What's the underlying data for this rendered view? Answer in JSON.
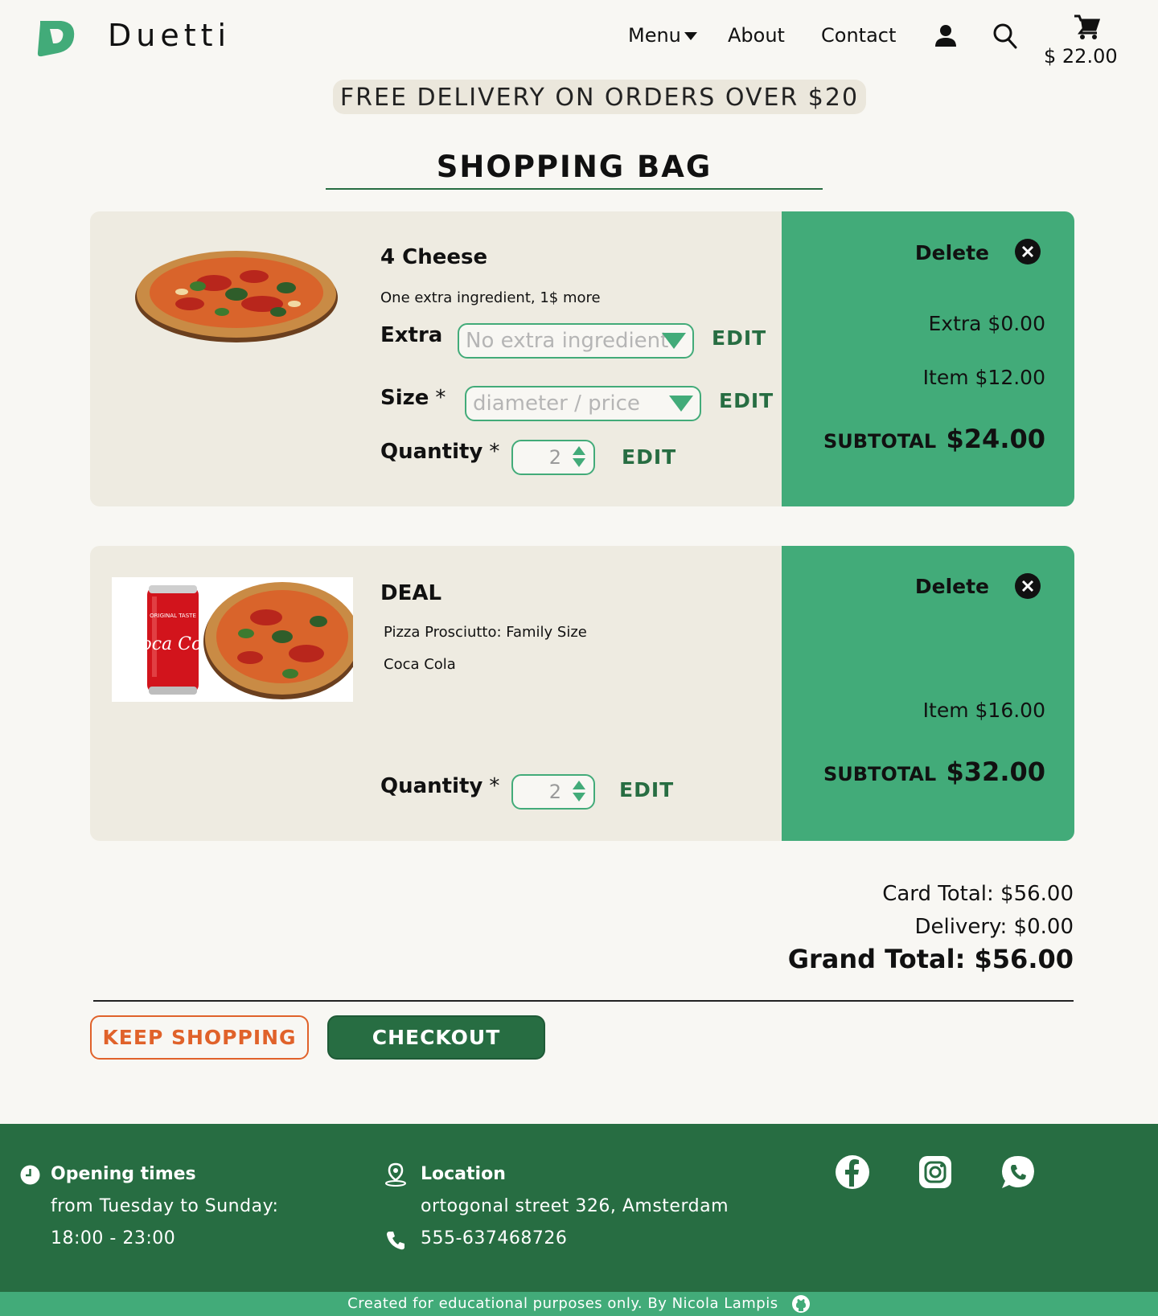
{
  "header": {
    "brand": "Duetti",
    "nav": {
      "menu": "Menu",
      "about": "About",
      "contact": "Contact"
    },
    "cart_total": "$ 22.00"
  },
  "banner": "FREE DELIVERY ON ORDERS OVER $20",
  "page_title": "SHOPPING BAG",
  "items": [
    {
      "name": "4 Cheese",
      "description": "One extra ingredient, 1$ more",
      "extra_label": "Extra",
      "extra_placeholder": "No extra ingredient",
      "size_label": "Size",
      "size_placeholder": "diameter / price",
      "quantity_label": "Quantity",
      "required_mark": "*",
      "quantity": "2",
      "edit_label": "EDIT",
      "delete_label": "Delete",
      "extra_price": "Extra $0.00",
      "item_price": "Item $12.00",
      "subtotal_label": "SUBTOTAL",
      "subtotal": "$24.00"
    },
    {
      "name": "DEAL",
      "lines": [
        "Pizza Prosciutto: Family Size",
        "Coca Cola"
      ],
      "quantity_label": "Quantity",
      "required_mark": "*",
      "quantity": "2",
      "edit_label": "EDIT",
      "delete_label": "Delete",
      "item_price": "Item $16.00",
      "subtotal_label": "SUBTOTAL",
      "subtotal": "$32.00",
      "image_text": "Coca Cola"
    }
  ],
  "totals": {
    "card": "Card Total: $56.00",
    "delivery": "Delivery: $0.00",
    "grand": "Grand Total: $56.00"
  },
  "buttons": {
    "keep_shopping": "KEEP SHOPPING",
    "checkout": "CHECKOUT"
  },
  "footer": {
    "opening_title": "Opening times",
    "opening_days": "from Tuesday to Sunday:",
    "opening_hours": "18:00 - 23:00",
    "location_title": "Location",
    "address": "ortogonal street 326, Amsterdam",
    "phone": "555-637468726",
    "credit": "Created for educational purposes only.  By Nicola Lampis"
  },
  "colors": {
    "green": "#42ab79",
    "dark_green": "#276d42",
    "orange": "#e0622a",
    "cream": "#eeebe1"
  }
}
